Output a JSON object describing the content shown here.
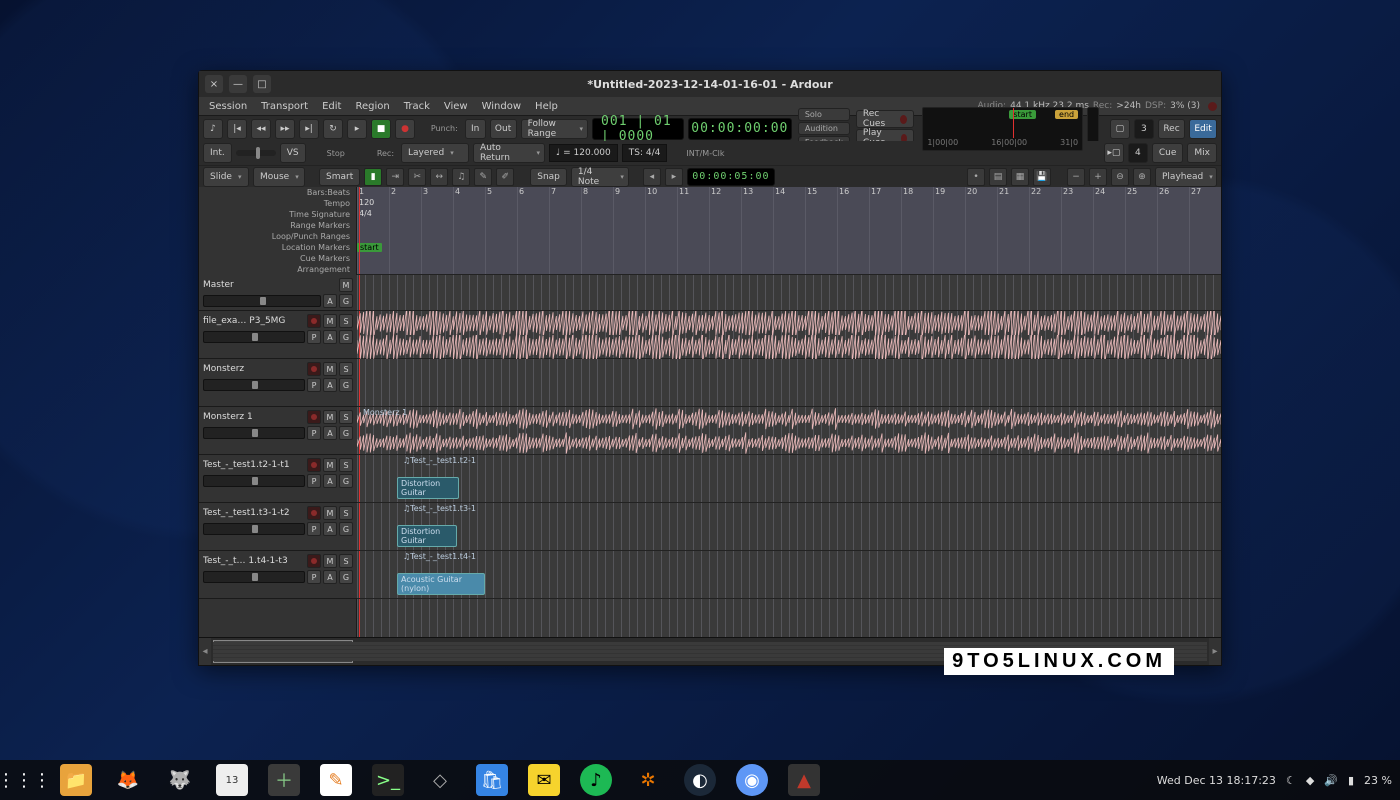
{
  "window": {
    "title": "*Untitled-2023-12-14-01-16-01 - Ardour",
    "close": "×",
    "min": "—",
    "max": "□"
  },
  "menu": [
    "Session",
    "Transport",
    "Edit",
    "Region",
    "Track",
    "View",
    "Window",
    "Help"
  ],
  "status": {
    "audio_label": "Audio:",
    "audio_val": "44.1 kHz 23.2 ms",
    "rec_label": "Rec:",
    "rec_val": ">24h",
    "dsp_label": "DSP:",
    "dsp_val": "3% (3)"
  },
  "transport": {
    "punch_label": "Punch:",
    "in": "In",
    "out": "Out",
    "follow": "Follow Range",
    "bbt": "001 | 01 | 0000",
    "tc": "00:00:00:00",
    "solo": "Solo",
    "audition": "Audition",
    "feedback": "Feedback",
    "rec_cues": "Rec Cues",
    "play_cues": "Play Cues",
    "start": "start",
    "end": "end",
    "tl_a": "1|00|00",
    "tl_b": "16|00|00",
    "tl_c": "31|0",
    "rec": "Rec",
    "edit": "Edit",
    "cue": "Cue",
    "mix": "Mix",
    "num3": "3",
    "num4": "4"
  },
  "row2": {
    "int": "Int.",
    "vs": "VS",
    "stop": "Stop",
    "rec": "Rec:",
    "layered": "Layered",
    "auto_return": "Auto Return",
    "tempo": "♩ = 120.000",
    "ts": "TS: 4/4",
    "sync": "INT/M-Clk"
  },
  "tools": {
    "slide": "Slide",
    "mouse": "Mouse",
    "smart": "Smart",
    "snap": "Snap",
    "grid": "1/4 Note",
    "time": "00:00:05:00",
    "playhead": "Playhead"
  },
  "ruler_labels": [
    "Bars:Beats",
    "Tempo",
    "Time Signature",
    "Range Markers",
    "Loop/Punch Ranges",
    "Location Markers",
    "Cue Markers",
    "Arrangement"
  ],
  "ruler_tempo": "120",
  "ruler_sig": "4/4",
  "loc_start": "start",
  "bars": [
    "1",
    "2",
    "3",
    "4",
    "5",
    "6",
    "7",
    "8",
    "9",
    "10",
    "11",
    "12",
    "13",
    "14",
    "15",
    "16",
    "17",
    "18",
    "19",
    "20",
    "21",
    "22",
    "23",
    "24",
    "25",
    "26",
    "27"
  ],
  "tracks": [
    {
      "name": "Master",
      "btns": [
        "M"
      ],
      "btns2": [
        "A",
        "G"
      ],
      "h": 36,
      "fader": true
    },
    {
      "name": "file_exa…  P3_5MG",
      "btns": [
        "●",
        "M",
        "S"
      ],
      "btns2": [
        "P",
        "A",
        "G"
      ],
      "h": 48,
      "fader": true
    },
    {
      "name": "Monsterz",
      "btns": [
        "●",
        "M",
        "S"
      ],
      "btns2": [
        "P",
        "A",
        "G"
      ],
      "h": 48,
      "fader": true
    },
    {
      "name": "Monsterz 1",
      "btns": [
        "●",
        "M",
        "S"
      ],
      "btns2": [
        "P",
        "A",
        "G"
      ],
      "h": 48,
      "fader": true
    },
    {
      "name": "Test_-_test1.t2-1-t1",
      "btns": [
        "●",
        "M",
        "S"
      ],
      "btns2": [
        "P",
        "A",
        "G"
      ],
      "h": 48,
      "fader": true
    },
    {
      "name": "Test_-_test1.t3-1-t2",
      "btns": [
        "●",
        "M",
        "S"
      ],
      "btns2": [
        "P",
        "A",
        "G"
      ],
      "h": 48,
      "fader": true
    },
    {
      "name": "Test_-_t… 1.t4-1-t3",
      "btns": [
        "●",
        "M",
        "S"
      ],
      "btns2": [
        "P",
        "A",
        "G"
      ],
      "h": 48,
      "fader": true
    }
  ],
  "regions": {
    "monsterz1": "Monsterz 1",
    "t2_label": "♫Test_-_test1.t2-1",
    "t2_reg": "Distortion Guitar",
    "t3_label": "♫Test_-_test1.t3-1",
    "t3_reg": "Distortion Guitar",
    "t4_label": "♫Test_-_test1.t4-1",
    "t4_reg": "Acoustic Guitar (nylon)"
  },
  "taskbar": {
    "clock": "Wed Dec 13  18:17:23",
    "battery": "23 %"
  },
  "watermark": "9TO5LINUX.COM"
}
